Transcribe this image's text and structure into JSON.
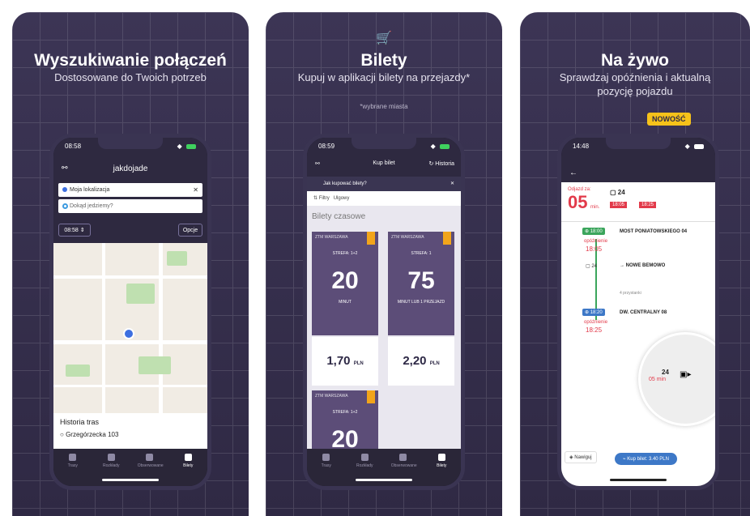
{
  "cards": [
    {
      "title": "Wyszukiwanie połączeń",
      "subtitle": "Dostosowane do Twoich potrzeb",
      "phone": {
        "time": "08:58",
        "app_title": "jakdojade",
        "from_placeholder": "Moja lokalizacja",
        "to_placeholder": "Dokąd jedziemy?",
        "time_select": "08:58",
        "options_button": "Opcje",
        "history_title": "Historia tras",
        "history_items": [
          "Grzegórzecka 103"
        ],
        "tabs": [
          "Trasy",
          "Rozkłady",
          "Obserwowane",
          "Bilety"
        ]
      }
    },
    {
      "title": "Bilety",
      "subtitle": "Kupuj w aplikacji bilety na przejazdy*",
      "note": "*wybrane miasta",
      "phone": {
        "time": "08:59",
        "header_title": "Kup bilet",
        "history_button": "Historia",
        "info_text": "Jak kupować bilety?",
        "filters": "Filtry",
        "discount": "Ulgowy",
        "section_title": "Bilety czasowe",
        "tickets": [
          {
            "operator": "ZTM WARSZAWA",
            "zone": "STREFA: 1+2",
            "value": "20",
            "unit": "MINUT",
            "price": "1,70",
            "currency": "PLN"
          },
          {
            "operator": "ZTM WARSZAWA",
            "zone": "STREFA: 1",
            "value": "75",
            "unit": "MINUT LUB 1 PRZEJAZD",
            "price": "2,20",
            "currency": "PLN"
          },
          {
            "operator": "ZTM WARSZAWA",
            "zone": "STREFA: 1+2",
            "value": "20"
          }
        ],
        "tabs": [
          "Trasy",
          "Rozkłady",
          "Obserwowane",
          "Bilety"
        ]
      }
    },
    {
      "title": "Na żywo",
      "subtitle_line1": "Sprawdzaj opóźnienia i aktualną",
      "subtitle_line2": "pozycję pojazdu",
      "badge": "NOWOŚĆ",
      "phone": {
        "time": "14:48",
        "departure_label": "Odjazd za:",
        "countdown": "05",
        "countdown_unit": "min.",
        "line": "24",
        "sched_time": "18:05",
        "real_time": "18:25",
        "stop1_time": "18:00",
        "stop1_name": "MOST PONIATOWSKIEGO 04",
        "delay_label": "opóźnienie",
        "stop1_delay": "18:05",
        "route_line": "24",
        "route_dest": "→ NOWE BEMOWO",
        "stops_count": "4 przystanki",
        "stop2_time": "18:20",
        "stop2_name": "DW. CENTRALNY 08",
        "stop2_delay": "18:25",
        "map_line": "24",
        "map_eta": "05 min",
        "nav_button": "Nawiguj",
        "buy_button": "Kup bilet: 3.40 PLN"
      }
    }
  ]
}
